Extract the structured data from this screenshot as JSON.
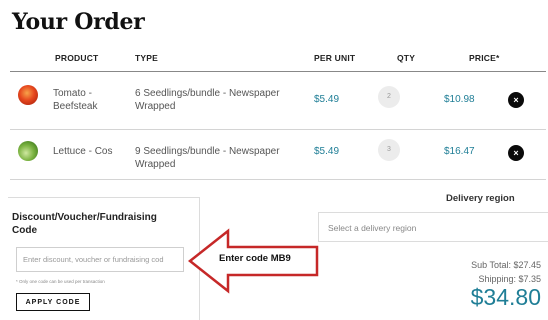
{
  "order": {
    "title": "Your Order"
  },
  "table": {
    "headers": {
      "product": "PRODUCT",
      "type": "TYPE",
      "per_unit": "PER UNIT",
      "qty": "QTY",
      "price": "PRICE*"
    },
    "rows": [
      {
        "icon": "tomato-thumbnail",
        "product_line1": "Tomato -",
        "product_line2": "Beefsteak",
        "type_line1": "6 Seedlings/bundle - Newspaper",
        "type_line2": "Wrapped",
        "per_unit": "$5.49",
        "qty": "2",
        "price": "$10.98",
        "remove_glyph": "×"
      },
      {
        "icon": "lettuce-thumbnail",
        "product_line1": "Lettuce - Cos",
        "product_line2": "",
        "type_line1": "9 Seedlings/bundle - Newspaper",
        "type_line2": "Wrapped",
        "per_unit": "$5.49",
        "qty": "3",
        "price": "$16.47",
        "remove_glyph": "×"
      }
    ]
  },
  "delivery": {
    "label": "Delivery region",
    "placeholder": "Select a delivery region"
  },
  "discount": {
    "title": "Discount/Voucher/Fundraising Code",
    "placeholder": "Enter discount, voucher or fundraising cod",
    "note": "* Only one code can be used per transaction",
    "apply_label": "APPLY CODE"
  },
  "annotation": {
    "label": "Enter code MB9",
    "arrow_color": "#c62828"
  },
  "totals": {
    "subtotal": "Sub Total: $27.45",
    "shipping": "Shipping: $7.35",
    "total": "$34.80"
  },
  "colors": {
    "accent": "#1f7e96",
    "arrow": "#c62828",
    "text": "#333333"
  }
}
